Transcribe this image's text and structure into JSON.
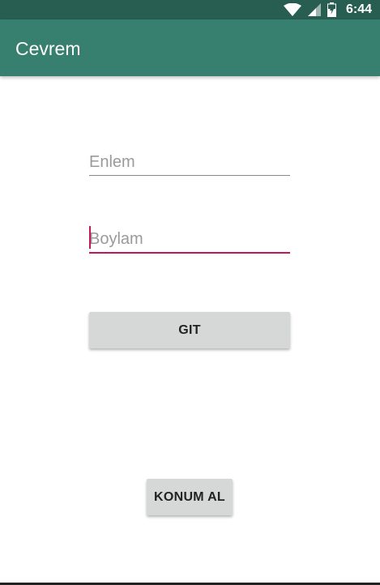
{
  "status_bar": {
    "time": "6:44",
    "icons": [
      "wifi-icon",
      "signal-icon",
      "battery-icon"
    ],
    "background": "#285e52"
  },
  "app_bar": {
    "title": "Cevrem",
    "background": "#377f6f"
  },
  "form": {
    "latitude": {
      "placeholder": "Enlem",
      "value": ""
    },
    "longitude": {
      "placeholder": "Boylam",
      "value": "",
      "focused": true,
      "accent_color": "#c2185b"
    },
    "go_button": "GIT",
    "location_button": "KONUM AL"
  },
  "colors": {
    "button_background": "#d6d7d7",
    "accent": "#c2185b"
  }
}
